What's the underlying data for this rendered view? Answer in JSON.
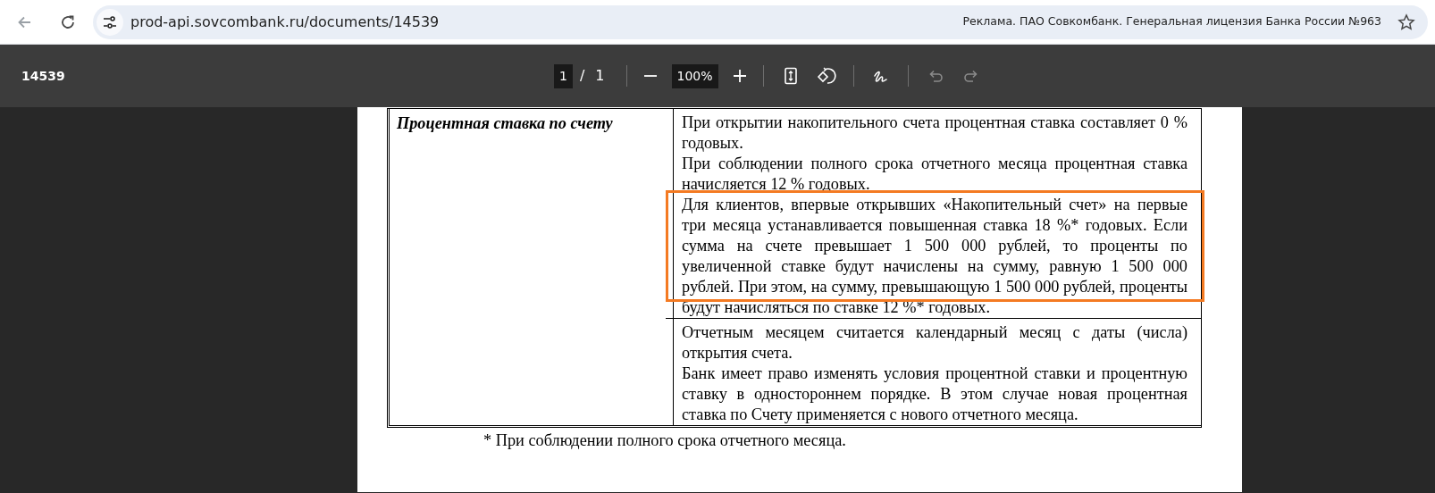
{
  "browser": {
    "url": "prod-api.sovcombank.ru/documents/14539",
    "ad_text": "Реклама. ПАО Совкомбанк. Генеральная лицензия Банка России №963",
    "back_disabled": true,
    "bookmarked": false
  },
  "viewer": {
    "title": "14539",
    "page": "1",
    "page_separator": "/",
    "page_total": "1",
    "zoom": "100%",
    "tools": [
      {
        "kind": "fit",
        "disabled": false
      },
      {
        "kind": "rotate",
        "disabled": false
      },
      {
        "kind": "draw",
        "disabled": false
      },
      {
        "kind": "undo",
        "disabled": true
      },
      {
        "kind": "redo",
        "disabled": true
      }
    ]
  },
  "document": {
    "rows": [
      {
        "label": "Процентная ставка по счету",
        "groups": [
          [
            {
              "text": "При открытии накопительного счета процентная ставка составляет 0 % годовых.",
              "highlighted": false
            },
            {
              "text": "При соблюдении полного срока отчетного месяца процентная ставка начисляется 12 % годовых.",
              "highlighted": false
            },
            {
              "text": "Для клиентов, впервые открывших «Накопительный счет» на первые три месяца устанавливается повышенная ставка 18 %* годовых. Если сумма на счете превышает 1 500 000 рублей, то проценты по увеличенной ставке будут начислены на сумму, равную 1 500 000 рублей. При этом, на сумму, превышающую 1 500 000 рублей, проценты будут начисляться по ставке 12 %* годовых.",
              "highlighted": true
            }
          ],
          [
            {
              "text": "Отчетным месяцем считается календарный месяц с даты (числа) открытия счета.",
              "highlighted": false
            },
            {
              "text": "Банк имеет право изменять условия процентной ставки и процентную ставку в одностороннем порядке. В этом случае новая процентная ставка по Счету применяется с нового отчетного месяца.",
              "highlighted": false
            }
          ]
        ]
      }
    ],
    "footnote": "* При соблюдении полного срока отчетного месяца."
  }
}
